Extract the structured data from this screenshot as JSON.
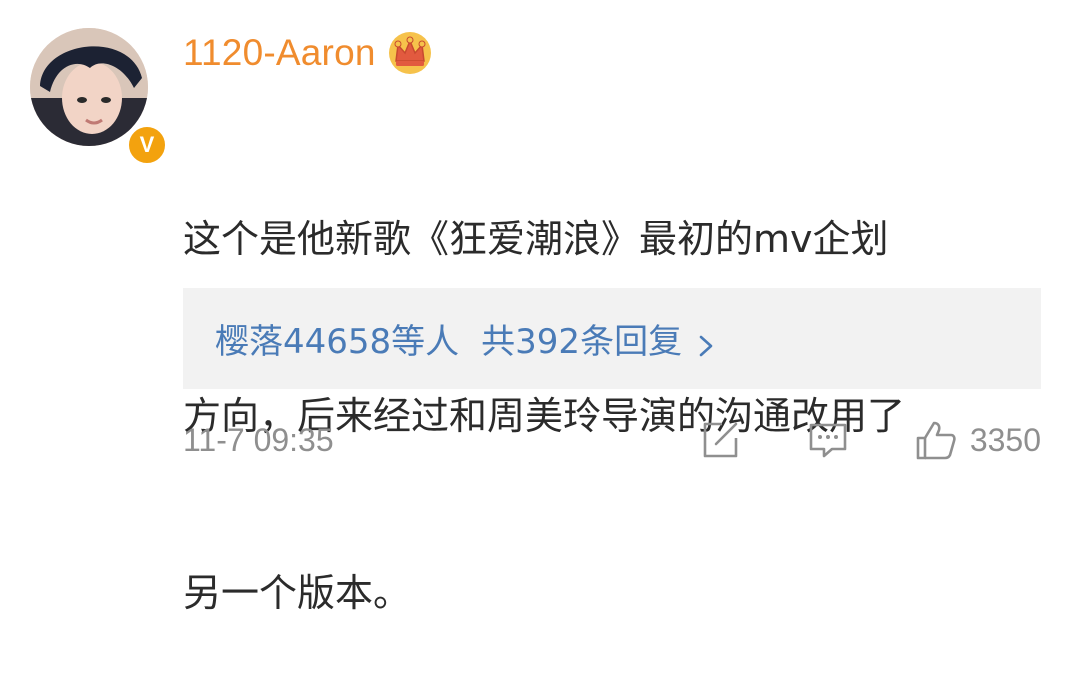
{
  "user": {
    "name": "1120-Aaron",
    "verified_badge_letter": "V",
    "crown_icon": "crown-icon",
    "name_color": "#f08c2e"
  },
  "comment": {
    "lines": [
      "这个是他新歌《狂爱潮浪》最初的mv企划",
      "方向，后来经过和周美玲导演的沟通改用了",
      "另一个版本。"
    ]
  },
  "replies": {
    "users_text": "樱落44658等人",
    "count_text": "共392条回复",
    "link_color": "#4a7bb7"
  },
  "footer": {
    "timestamp": "11-7 09:35",
    "like_count": "3350",
    "icons": [
      "share-icon",
      "comment-icon",
      "thumbs-up-icon"
    ]
  }
}
